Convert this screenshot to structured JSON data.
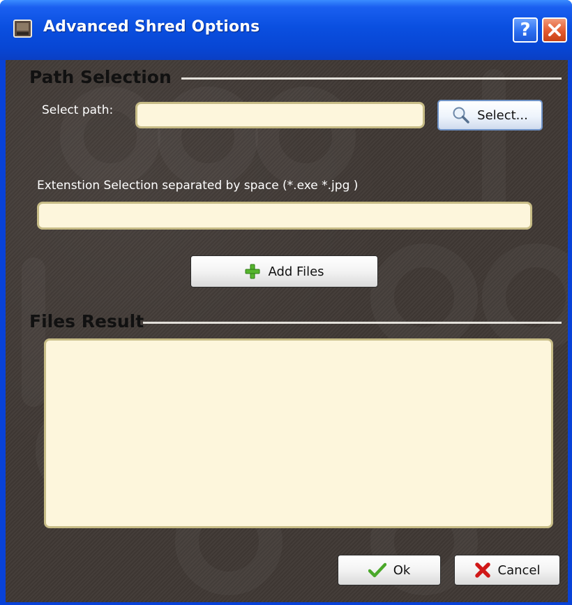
{
  "window": {
    "title": "Advanced Shred Options"
  },
  "titlebar": {
    "help_glyph": "?",
    "help_icon": "help-icon",
    "close_icon": "close-icon"
  },
  "path_section": {
    "title": "Path Selection",
    "select_path_label": "Select path:",
    "path_value": "",
    "select_button_label": "Select...",
    "select_button_icon": "magnifier-icon",
    "extension_label": "Extenstion Selection separated by space (*.exe *.jpg )",
    "extension_value": "",
    "add_files_label": "Add Files",
    "add_files_icon": "plus-icon"
  },
  "files_section": {
    "title": "Files Result",
    "result_value": ""
  },
  "footer": {
    "ok_label": "Ok",
    "ok_icon": "checkmark-icon",
    "cancel_label": "Cancel",
    "cancel_icon": "cross-icon"
  },
  "colors": {
    "titlebar_blue": "#0a4fe0",
    "panel_bg": "#3f3834",
    "field_bg": "#fdf6dc",
    "field_border": "#c7bc86",
    "close_red": "#e35a2f",
    "ok_green": "#4aa82a",
    "cancel_red": "#d01818"
  }
}
